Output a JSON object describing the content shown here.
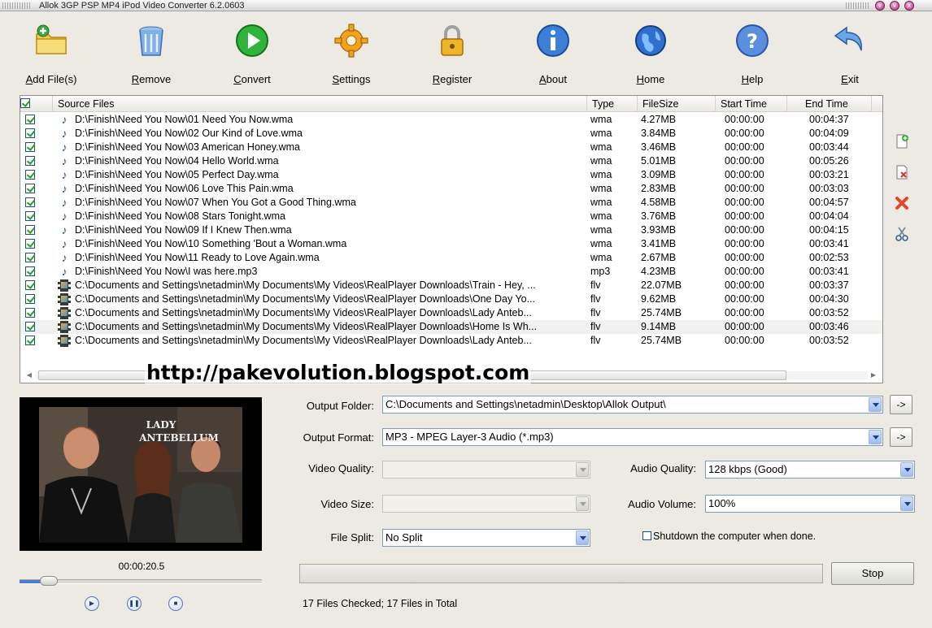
{
  "window": {
    "title": "Allok 3GP PSP MP4 iPod Video Converter 6.2.0603",
    "controls": [
      "minimize",
      "maximize",
      "close"
    ]
  },
  "toolbar": {
    "items": [
      {
        "label": "Add File(s)",
        "icon": "add-folder-icon"
      },
      {
        "label": "Remove",
        "icon": "trash-icon"
      },
      {
        "label": "Convert",
        "icon": "play-icon"
      },
      {
        "label": "Settings",
        "icon": "gear-icon"
      },
      {
        "label": "Register",
        "icon": "lock-icon"
      },
      {
        "label": "About",
        "icon": "info-icon"
      },
      {
        "label": "Home",
        "icon": "globe-icon"
      },
      {
        "label": "Help",
        "icon": "help-icon"
      },
      {
        "label": "Exit",
        "icon": "exit-arrow-icon"
      }
    ]
  },
  "filelist": {
    "columns": [
      "Source Files",
      "Type",
      "FileSize",
      "Start Time",
      "End Time"
    ],
    "rows": [
      {
        "path": "D:\\Finish\\Need You Now\\01 Need You Now.wma",
        "type": "wma",
        "size": "4.27MB",
        "start": "00:00:00",
        "end": "00:04:37",
        "kind": "audio"
      },
      {
        "path": "D:\\Finish\\Need You Now\\02 Our Kind of Love.wma",
        "type": "wma",
        "size": "3.84MB",
        "start": "00:00:00",
        "end": "00:04:09",
        "kind": "audio"
      },
      {
        "path": "D:\\Finish\\Need You Now\\03 American Honey.wma",
        "type": "wma",
        "size": "3.46MB",
        "start": "00:00:00",
        "end": "00:03:44",
        "kind": "audio"
      },
      {
        "path": "D:\\Finish\\Need You Now\\04 Hello World.wma",
        "type": "wma",
        "size": "5.01MB",
        "start": "00:00:00",
        "end": "00:05:26",
        "kind": "audio"
      },
      {
        "path": "D:\\Finish\\Need You Now\\05 Perfect Day.wma",
        "type": "wma",
        "size": "3.09MB",
        "start": "00:00:00",
        "end": "00:03:21",
        "kind": "audio"
      },
      {
        "path": "D:\\Finish\\Need You Now\\06 Love This Pain.wma",
        "type": "wma",
        "size": "2.83MB",
        "start": "00:00:00",
        "end": "00:03:03",
        "kind": "audio"
      },
      {
        "path": "D:\\Finish\\Need You Now\\07 When You Got a Good Thing.wma",
        "type": "wma",
        "size": "4.58MB",
        "start": "00:00:00",
        "end": "00:04:57",
        "kind": "audio"
      },
      {
        "path": "D:\\Finish\\Need You Now\\08 Stars Tonight.wma",
        "type": "wma",
        "size": "3.76MB",
        "start": "00:00:00",
        "end": "00:04:04",
        "kind": "audio"
      },
      {
        "path": "D:\\Finish\\Need You Now\\09 If I Knew Then.wma",
        "type": "wma",
        "size": "3.93MB",
        "start": "00:00:00",
        "end": "00:04:15",
        "kind": "audio"
      },
      {
        "path": "D:\\Finish\\Need You Now\\10 Something 'Bout a Woman.wma",
        "type": "wma",
        "size": "3.41MB",
        "start": "00:00:00",
        "end": "00:03:41",
        "kind": "audio"
      },
      {
        "path": "D:\\Finish\\Need You Now\\11 Ready to Love Again.wma",
        "type": "wma",
        "size": "2.67MB",
        "start": "00:00:00",
        "end": "00:02:53",
        "kind": "audio"
      },
      {
        "path": "D:\\Finish\\Need You Now\\I was here.mp3",
        "type": "mp3",
        "size": "4.23MB",
        "start": "00:00:00",
        "end": "00:03:41",
        "kind": "audio"
      },
      {
        "path": "C:\\Documents and Settings\\netadmin\\My Documents\\My Videos\\RealPlayer Downloads\\Train - Hey, ...",
        "type": "flv",
        "size": "22.07MB",
        "start": "00:00:00",
        "end": "00:03:37",
        "kind": "video"
      },
      {
        "path": "C:\\Documents and Settings\\netadmin\\My Documents\\My Videos\\RealPlayer Downloads\\One Day Yo...",
        "type": "flv",
        "size": "9.62MB",
        "start": "00:00:00",
        "end": "00:04:30",
        "kind": "video"
      },
      {
        "path": "C:\\Documents and Settings\\netadmin\\My Documents\\My Videos\\RealPlayer Downloads\\Lady Anteb...",
        "type": "flv",
        "size": "25.74MB",
        "start": "00:00:00",
        "end": "00:03:52",
        "kind": "video"
      },
      {
        "path": "C:\\Documents and Settings\\netadmin\\My Documents\\My Videos\\RealPlayer Downloads\\Home Is Wh...",
        "type": "flv",
        "size": "9.14MB",
        "start": "00:00:00",
        "end": "00:03:46",
        "kind": "video"
      },
      {
        "path": "C:\\Documents and Settings\\netadmin\\My Documents\\My Videos\\RealPlayer Downloads\\Lady Anteb...",
        "type": "flv",
        "size": "25.74MB",
        "start": "00:00:00",
        "end": "00:03:52",
        "kind": "video"
      }
    ]
  },
  "side_icons": [
    "add-file-icon",
    "remove-file-icon",
    "delete-icon",
    "cut-icon"
  ],
  "watermark": "http://pakevolution.blogspot.com",
  "preview": {
    "banner_text": "LADY ANTEBELLUM",
    "time": "00:00:20.5",
    "seek_fraction": 0.12
  },
  "options": {
    "output_folder_label": "Output Folder:",
    "output_folder_value": "C:\\Documents and Settings\\netadmin\\Desktop\\Allok Output\\",
    "output_format_label": "Output Format:",
    "output_format_value": "MP3 - MPEG Layer-3 Audio (*.mp3)",
    "video_quality_label": "Video Quality:",
    "video_quality_value": "",
    "video_size_label": "Video Size:",
    "video_size_value": "",
    "file_split_label": "File Split:",
    "file_split_value": "No Split",
    "audio_quality_label": "Audio Quality:",
    "audio_quality_value": "128 kbps (Good)",
    "audio_volume_label": "Audio Volume:",
    "audio_volume_value": "100%",
    "shutdown_label": "Shutdown the computer when done.",
    "browse_label": "->"
  },
  "progress_fraction": 0,
  "stop_label": "Stop",
  "status": "17 Files Checked; 17 Files in Total"
}
